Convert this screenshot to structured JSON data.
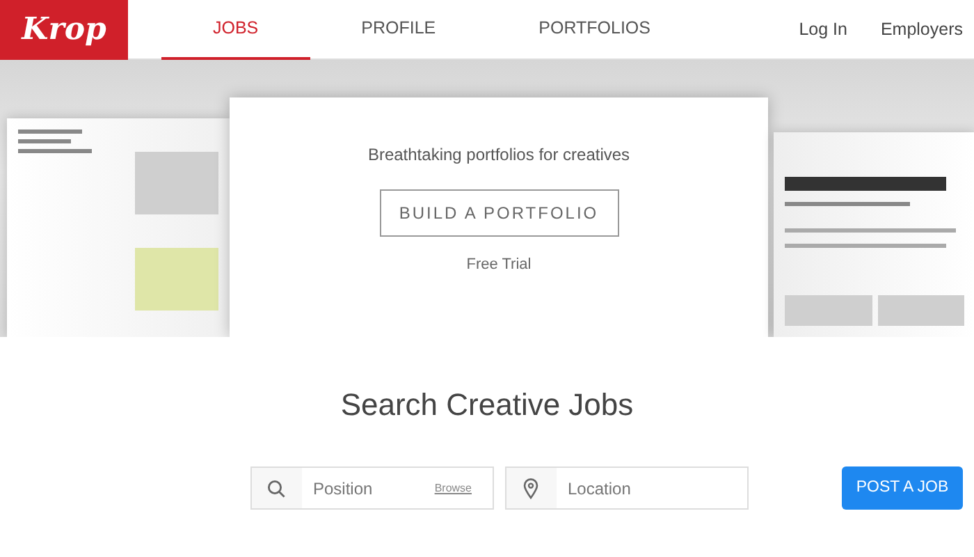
{
  "logo": "Krop",
  "nav": [
    {
      "label": "JOBS",
      "selected": true
    },
    {
      "label": "PROFILE",
      "selected": false
    },
    {
      "label": "PORTFOLIOS",
      "selected": false
    }
  ],
  "nav_right": [
    "Log In",
    "Employers"
  ],
  "hero": {
    "tagline": "Breathtaking portfolios for creatives",
    "button": "BUILD A PORTFOLIO",
    "note": "Free Trial"
  },
  "search": {
    "heading": "Search Creative Jobs",
    "position": {
      "placeholder": "Position",
      "link": "Browse"
    },
    "location": {
      "placeholder": "Location"
    },
    "button": "POST A JOB"
  }
}
